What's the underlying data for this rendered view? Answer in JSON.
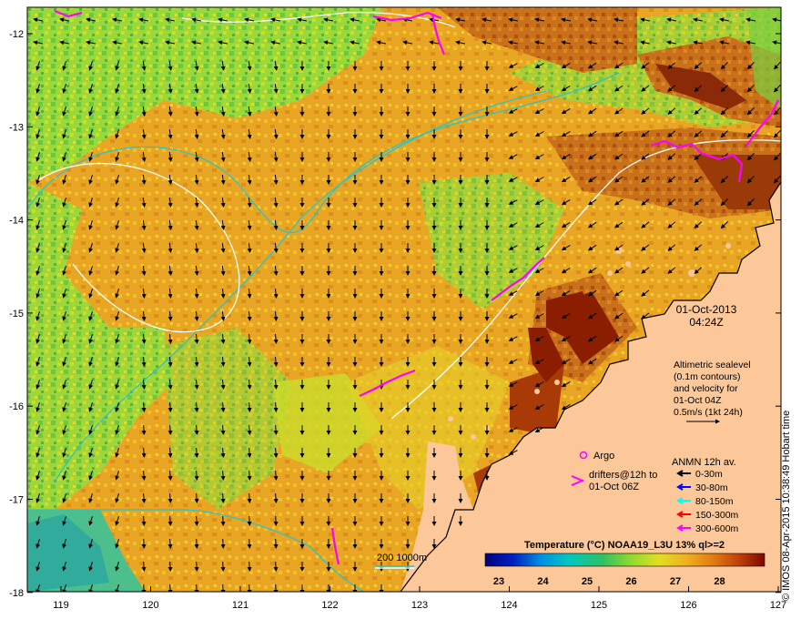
{
  "map": {
    "date_line1": "01-Oct-2013",
    "date_line2": "04:24Z",
    "lon_ticks": [
      "119",
      "120",
      "121",
      "122",
      "123",
      "124",
      "125",
      "126",
      "127"
    ],
    "lat_ticks": [
      "-12",
      "-13",
      "-14",
      "-15",
      "-16",
      "-17",
      "-18"
    ],
    "altimetry_note": [
      "Altimetric sealevel",
      "(0.1m contours)",
      "and velocity for",
      "01-Oct 04Z",
      "0.5m/s (1kt 24h)"
    ],
    "argo_label": "Argo",
    "drifters_label": [
      "drifters@12h to",
      "01-Oct 06Z"
    ],
    "anmn_title": "ANMN 12h av.",
    "anmn_legend": [
      {
        "label": "0-30m",
        "color": "#000000"
      },
      {
        "label": "30-80m",
        "color": "#0000ff"
      },
      {
        "label": "80-150m",
        "color": "#00ffff"
      },
      {
        "label": "150-300m",
        "color": "#ff0000"
      },
      {
        "label": "300-600m",
        "color": "#ff00ff"
      }
    ],
    "isobath_label": "200  1000m",
    "colorbar_title": "Temperature (°C) NOAA19_L3U 13% ql>=2",
    "colorbar_ticks": [
      "23",
      "24",
      "25",
      "26",
      "27",
      "28"
    ],
    "credit": "© IMOS 08-Apr-2015 10:38:49 Hobart time",
    "colors": {
      "land": "#fcc89a",
      "ocean_base": "#e6a01e",
      "ocean_green": "#7bd23c",
      "ocean_warm": "#c86414",
      "hot": "#8b1e00",
      "isobath_1000": "#2bc4c4",
      "isobath_200": "#ffffff",
      "drifter": "#ff00ff"
    }
  }
}
